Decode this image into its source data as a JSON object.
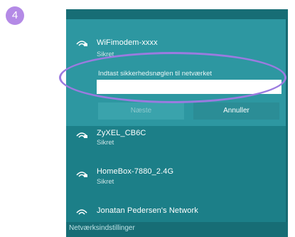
{
  "step": {
    "number": "4"
  },
  "colors": {
    "panel": "#1c7f88",
    "selected_row": "#2d97a1",
    "accent_ring": "#9b7be0",
    "badge": "#b48ae6"
  },
  "networks": [
    {
      "name": "WiFimodem-xxxx",
      "status": "Sikret",
      "icon": "wifi-secured-icon",
      "selected": true,
      "prompt": "Indtast sikkerhedsnøglen til netværket",
      "key_value": "",
      "next_label": "Næste",
      "cancel_label": "Annuller"
    },
    {
      "name": "ZyXEL_CB6C",
      "status": "Sikret",
      "icon": "wifi-secured-icon"
    },
    {
      "name": "HomeBox-7880_2.4G",
      "status": "Sikret",
      "icon": "wifi-secured-icon"
    },
    {
      "name": "Jonatan Pedersen's Network",
      "status": "",
      "icon": "wifi-icon"
    }
  ],
  "footer": {
    "settings_label": "Netværksindstillinger"
  }
}
